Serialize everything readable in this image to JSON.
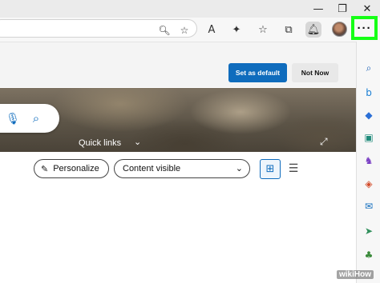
{
  "window": {
    "minimize_glyph": "—",
    "restore_glyph": "❐",
    "close_glyph": "✕"
  },
  "toolbar": {
    "zoom_icon": "🔍︎",
    "favorite_add_icon": "☆",
    "read_aloud_icon": "A",
    "extensions_icon": "✦",
    "favorites_icon": "☆",
    "collections_icon": "⧉",
    "notifications_icon": "🔔︎",
    "more_button_label": "···",
    "highlight_color": "#16ff16"
  },
  "banner": {
    "set_default_label": "Set as default",
    "not_now_label": "Not Now",
    "primary_color": "#0f6cbd"
  },
  "hero": {
    "mic_icon": "🎙︎",
    "search_icon": "⌕",
    "quick_links_label": "Quick links",
    "chevron": "⌄",
    "expand_icon": "⤢"
  },
  "controls": {
    "personalize_label": "Personalize",
    "personalize_icon": "✎",
    "content_label": "Content visible",
    "content_chevron": "⌄",
    "grid_icon": "⊞",
    "list_icon": "☰"
  },
  "sidebar": {
    "items": [
      {
        "name": "search-icon",
        "glyph": "⌕",
        "color": "#1a5fb4"
      },
      {
        "name": "bing-chat-icon",
        "glyph": "b",
        "color": "#1a7fd4"
      },
      {
        "name": "shopping-tag-icon",
        "glyph": "◆",
        "color": "#2b6fd6"
      },
      {
        "name": "tools-icon",
        "glyph": "▣",
        "color": "#1f8a7a"
      },
      {
        "name": "games-icon",
        "glyph": "♞",
        "color": "#7a3fc4"
      },
      {
        "name": "office-icon",
        "glyph": "◈",
        "color": "#d34b2a"
      },
      {
        "name": "outlook-icon",
        "glyph": "✉",
        "color": "#0f6cbd"
      },
      {
        "name": "send-icon",
        "glyph": "➤",
        "color": "#2f8f5b"
      },
      {
        "name": "tree-icon",
        "glyph": "♣",
        "color": "#3a8a3a"
      }
    ]
  },
  "watermark": "wikiHow"
}
